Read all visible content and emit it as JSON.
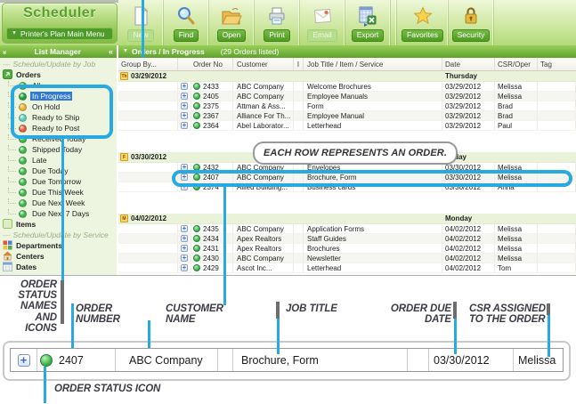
{
  "toolbar": {
    "app_title": "Scheduler",
    "main_menu_label": "Printer's Plan Main Menu",
    "buttons": [
      {
        "label": "New",
        "icon": "new-document-icon",
        "disabled": true
      },
      {
        "label": "Find",
        "icon": "find-magnifier-icon",
        "disabled": false
      },
      {
        "label": "Open",
        "icon": "open-folder-icon",
        "disabled": false
      },
      {
        "label": "Print",
        "icon": "printer-icon",
        "disabled": false
      },
      {
        "label": "Email",
        "icon": "email-envelope-icon",
        "disabled": true
      },
      {
        "label": "Export",
        "icon": "export-excel-icon",
        "disabled": false
      },
      {
        "label": "Favorites",
        "icon": "favorites-star-icon",
        "disabled": false
      },
      {
        "label": "Security",
        "icon": "security-lock-icon",
        "disabled": false
      }
    ]
  },
  "panel_bar": {
    "left_title": "List Manager",
    "collapse_glyph": "«",
    "chevrons_glyph": "»",
    "dropdown_glyph": "▼",
    "path_title": "Orders / In Progress",
    "count_text": "(29 Orders listed)"
  },
  "sidebar": {
    "section_job": "Schedule/Update by Job",
    "section_service": "Schedule/Update by Service",
    "orders_label": "Orders",
    "items_label": "Items",
    "statuses": [
      {
        "label": "All",
        "color": "#3fb54b",
        "selected": false
      },
      {
        "label": "In Progress",
        "color": "#1f9e3d",
        "selected": true
      },
      {
        "label": "On Hold",
        "color": "#f2ad2c",
        "selected": false
      },
      {
        "label": "Ready to Ship",
        "color": "#5ec8bf",
        "selected": false
      },
      {
        "label": "Ready to Post",
        "color": "#e8543f",
        "selected": false
      },
      {
        "label": "Received Today",
        "color": "#3fb54b",
        "selected": false
      },
      {
        "label": "Shipped Today",
        "color": "#3fb54b",
        "selected": false
      },
      {
        "label": "Late",
        "color": "#3fb54b",
        "selected": false
      },
      {
        "label": "Due Today",
        "color": "#3fb54b",
        "selected": false
      },
      {
        "label": "Due Tomorrow",
        "color": "#3fb54b",
        "selected": false
      },
      {
        "label": "Due This Week",
        "color": "#3fb54b",
        "selected": false
      },
      {
        "label": "Due Next Week",
        "color": "#3fb54b",
        "selected": false
      },
      {
        "label": "Due Next 7 Days",
        "color": "#3fb54b",
        "selected": false
      }
    ],
    "links": [
      {
        "label": "Departments",
        "icon": "departments-grid-icon"
      },
      {
        "label": "Centers",
        "icon": "centers-house-icon"
      },
      {
        "label": "Dates",
        "icon": "dates-calendar-icon"
      }
    ]
  },
  "table": {
    "columns": [
      "Group By...",
      "Order No",
      "Customer",
      "I",
      "Job Title / Item / Service",
      "Date",
      "CSR/Oper",
      "Tag"
    ],
    "groups": [
      {
        "date": "03/29/2012",
        "day_letter": "Th",
        "weekday": "Thursday",
        "rows": [
          {
            "no": "2433",
            "customer": "ABC Company",
            "job": "Welcome Brochures",
            "date": "03/29/2012",
            "csr": "Melissa"
          },
          {
            "no": "2405",
            "customer": "ABC Company",
            "job": "Employee Manuals",
            "date": "03/29/2012",
            "csr": "Melissa"
          },
          {
            "no": "2375",
            "customer": "Attman & Ass...",
            "job": "Form",
            "date": "03/29/2012",
            "csr": "Brad"
          },
          {
            "no": "2367",
            "customer": "Alliance For Th...",
            "job": "Employee Manual",
            "date": "03/29/2012",
            "csr": "Brad"
          },
          {
            "no": "2364",
            "customer": "Abel Laborator...",
            "job": "Letterhead",
            "date": "03/29/2012",
            "csr": "Paul"
          }
        ]
      },
      {
        "date": "03/30/2012",
        "day_letter": "F",
        "weekday": "Friday",
        "rows": [
          {
            "no": "2432",
            "customer": "ABC Company",
            "job": "Envelopes",
            "date": "03/30/2012",
            "csr": "Melissa"
          },
          {
            "no": "2407",
            "customer": "ABC Company",
            "job": "Brochure, Form",
            "date": "03/30/2012",
            "csr": "Melissa"
          },
          {
            "no": "2374",
            "customer": "Allied Building...",
            "job": "Business cards",
            "date": "03/30/2012",
            "csr": "Anna"
          }
        ]
      },
      {
        "date": "04/02/2012",
        "day_letter": "M",
        "weekday": "Monday",
        "rows": [
          {
            "no": "2435",
            "customer": "ABC Company",
            "job": "Application Forms",
            "date": "04/02/2012",
            "csr": "Melissa"
          },
          {
            "no": "2434",
            "customer": "Apex Realtors",
            "job": "Staff Guides",
            "date": "04/02/2012",
            "csr": "Melissa"
          },
          {
            "no": "2431",
            "customer": "Apex Realtors",
            "job": "Brochures",
            "date": "04/02/2012",
            "csr": "Melissa"
          },
          {
            "no": "2430",
            "customer": "ABC Company",
            "job": "Newsletter",
            "date": "04/02/2012",
            "csr": "Melissa"
          },
          {
            "no": "2429",
            "customer": "Ascot Inc...",
            "job": "Letterhead",
            "date": "04/02/2012",
            "csr": "Tom"
          }
        ]
      }
    ]
  },
  "annotations": {
    "bubble_text": "EACH ROW REPRESENTS AN ORDER.",
    "labels": {
      "status_names": "ORDER\nSTATUS\nNAMES AND\nICONS",
      "order_number": "ORDER\nNUMBER",
      "customer_name": "CUSTOMER\nNAME",
      "job_title": "JOB TITLE",
      "due_date": "ORDER DUE\nDATE",
      "csr": "CSR ASSIGNED\nTO THE ORDER",
      "status_icon": "ORDER STATUS ICON"
    },
    "magnified_row": {
      "order_no": "2407",
      "customer": "ABC Company",
      "job": "Brochure, Form",
      "date": "03/30/2012",
      "csr": "Melissa"
    }
  },
  "colors": {
    "annotation_blue": "#29a9e1",
    "annotation_gray": "#6e6e6e",
    "selection_blue": "#3179d8",
    "toolbar_pill_green": "#4e9a22",
    "status_green": "#3fb54b",
    "status_amber": "#f2ad2c",
    "status_teal": "#5ec8bf",
    "status_red": "#e8543f",
    "group_row_green": "#eaf3da"
  }
}
